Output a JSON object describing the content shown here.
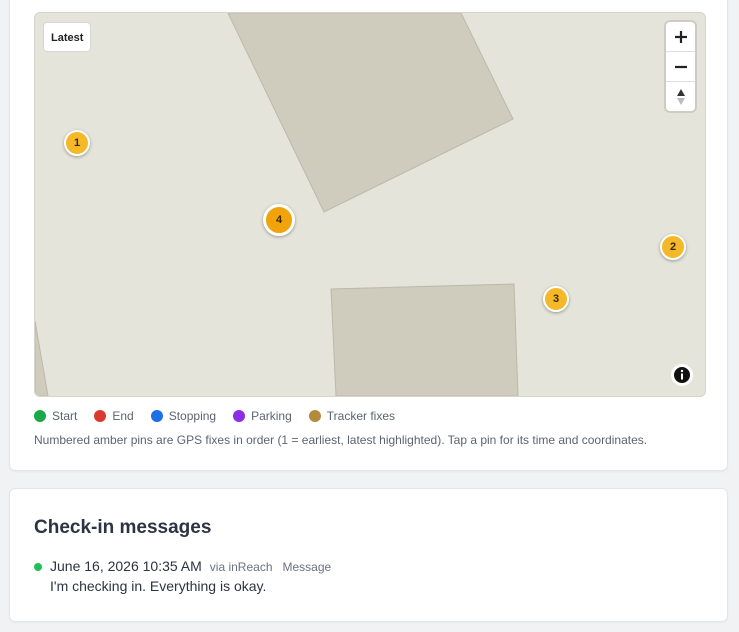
{
  "map": {
    "latest_button": "Latest",
    "controls": {
      "zoom_in_icon": "plus-icon",
      "zoom_out_icon": "minus-icon",
      "reset_north_icon": "compass-icon",
      "attribution_icon": "info-icon"
    },
    "pins": [
      {
        "label": "1",
        "latest": false
      },
      {
        "label": "2",
        "latest": false
      },
      {
        "label": "3",
        "latest": false
      },
      {
        "label": "4",
        "latest": true
      }
    ],
    "colors": {
      "land": "#e4e4da",
      "building": "#cfcbbd",
      "pin": "#f4b829",
      "pin_latest": "#f0a30a"
    }
  },
  "legend": [
    {
      "label": "Start",
      "color": "#1aa84a"
    },
    {
      "label": "End",
      "color": "#d93a2b"
    },
    {
      "label": "Stopping",
      "color": "#1f6fe5"
    },
    {
      "label": "Parking",
      "color": "#8b2ee6"
    },
    {
      "label": "Tracker fixes",
      "color": "#b58a3c"
    }
  ],
  "note": "Numbered amber pins are GPS fixes in order (1 = earliest, latest highlighted). Tap a pin for its time and coordinates.",
  "checkins": {
    "title": "Check-in messages",
    "messages": [
      {
        "time": "June 16, 2026 10:35 AM",
        "via": "via inReach",
        "type": "Message",
        "text": "I'm checking in. Everything is okay.",
        "status_color": "#1fbf5a"
      }
    ]
  }
}
